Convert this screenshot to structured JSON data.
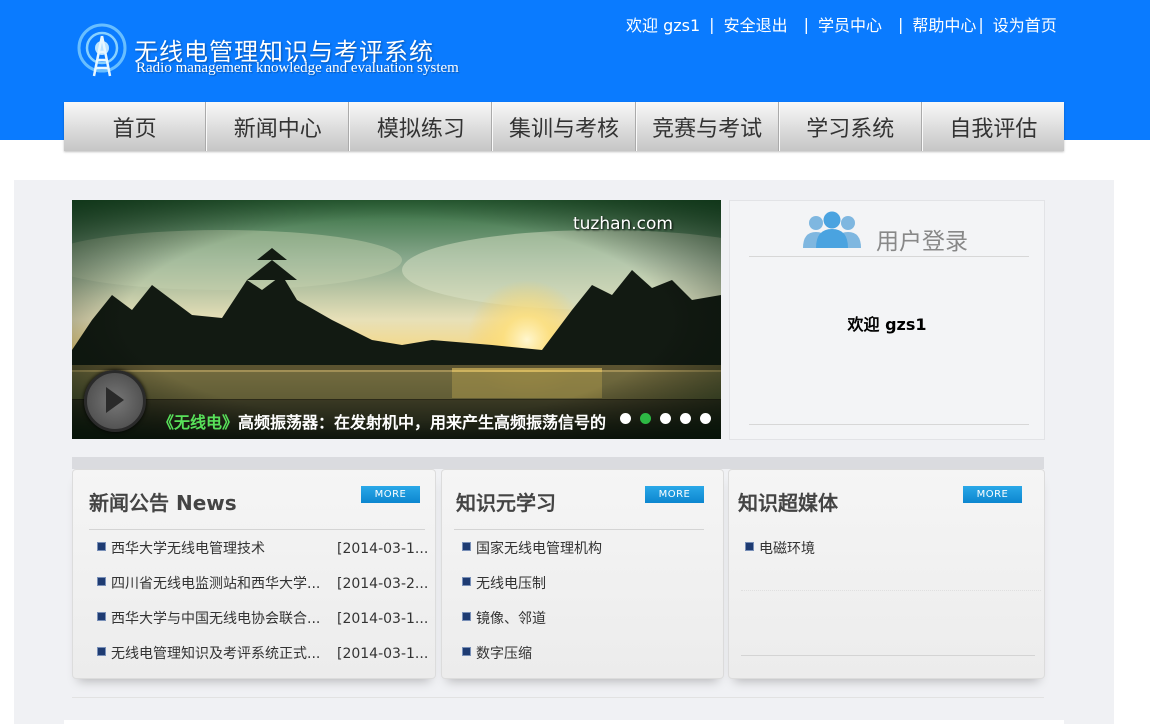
{
  "header": {
    "title_cn": "无线电管理知识与考评系统",
    "title_en": "Radio management knowledge and evaluation system",
    "links": [
      "欢迎 gzs1",
      "安全退出",
      "学员中心",
      "帮助中心",
      "设为首页"
    ],
    "separator": "|"
  },
  "nav": {
    "items": [
      "首页",
      "新闻中心",
      "模拟练习",
      "集训与考核",
      "竞赛与考试",
      "学习系统",
      "自我评估"
    ]
  },
  "banner": {
    "watermark": "tuzhan.com",
    "caption_tag": "《无线电》",
    "caption_text": "高频振荡器：在发射机中，用来产生高频振荡信号的",
    "slide_count": 5,
    "active_slide": 2
  },
  "login": {
    "title": "用户登录",
    "welcome": "欢迎 gzs1"
  },
  "panels": {
    "news": {
      "title": "新闻公告 News",
      "more": "MORE",
      "items": [
        {
          "text": "西华大学无线电管理技术",
          "date": "[2014-03-1..."
        },
        {
          "text": "四川省无线电监测站和西华大学...",
          "date": "[2014-03-2..."
        },
        {
          "text": "西华大学与中国无线电协会联合...",
          "date": "[2014-03-1..."
        },
        {
          "text": "无线电管理知识及考评系统正式...",
          "date": "[2014-03-1..."
        }
      ]
    },
    "knowledge": {
      "title": "知识元学习",
      "more": "MORE",
      "items": [
        "国家无线电管理机构",
        "无线电压制",
        "镜像、邻道",
        "数字压缩"
      ]
    },
    "media": {
      "title": "知识超媒体",
      "more": "MORE",
      "items": [
        "电磁环境"
      ]
    }
  },
  "colors": {
    "header_bg": "#0a7bff",
    "more_button": "#1497db",
    "active_dot": "#2db844",
    "caption_tag": "#58e05a"
  }
}
